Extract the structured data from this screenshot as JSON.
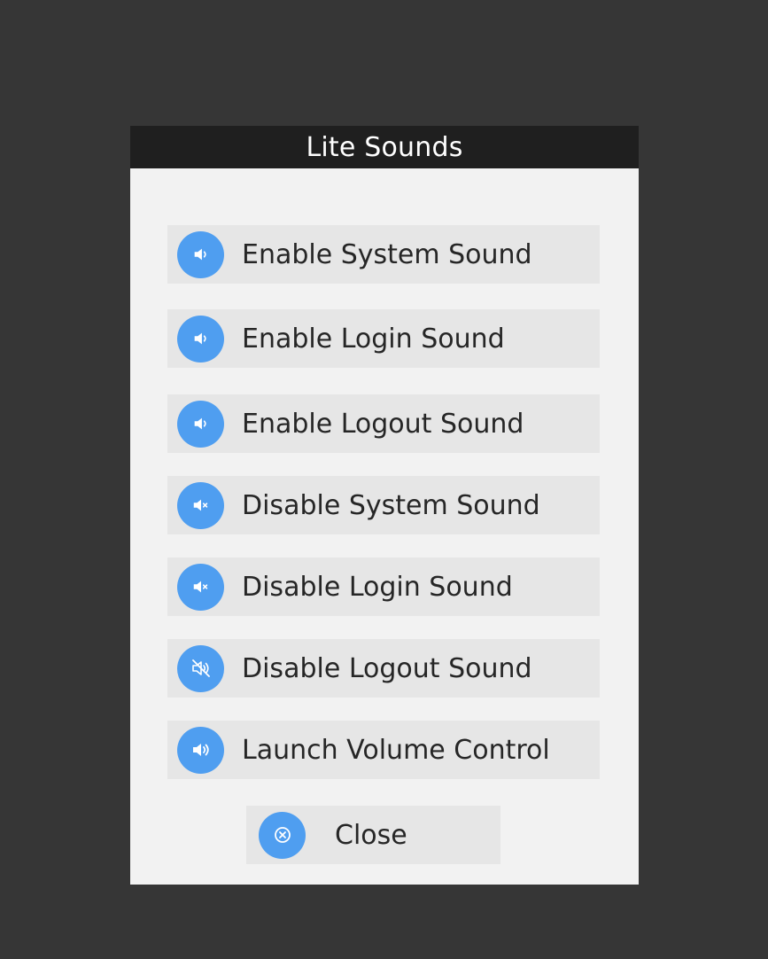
{
  "window": {
    "title": "Lite Sounds"
  },
  "buttons": [
    {
      "label": "Enable System Sound",
      "icon": "volume-low-icon"
    },
    {
      "label": "Enable Login Sound",
      "icon": "volume-low-icon"
    },
    {
      "label": "Enable Logout Sound",
      "icon": "volume-low-icon"
    },
    {
      "label": "Disable System Sound",
      "icon": "volume-mute-icon"
    },
    {
      "label": "Disable Login Sound",
      "icon": "volume-mute-icon"
    },
    {
      "label": "Disable Logout Sound",
      "icon": "volume-off-icon"
    },
    {
      "label": "Launch Volume Control",
      "icon": "volume-high-icon"
    }
  ],
  "close": {
    "label": "Close",
    "icon": "close-circle-icon"
  },
  "colors": {
    "background": "#363636",
    "titlebar": "#1f1f1f",
    "dialog": "#f2f2f2",
    "button": "#e6e6e6",
    "accent": "#4f9ef0"
  }
}
